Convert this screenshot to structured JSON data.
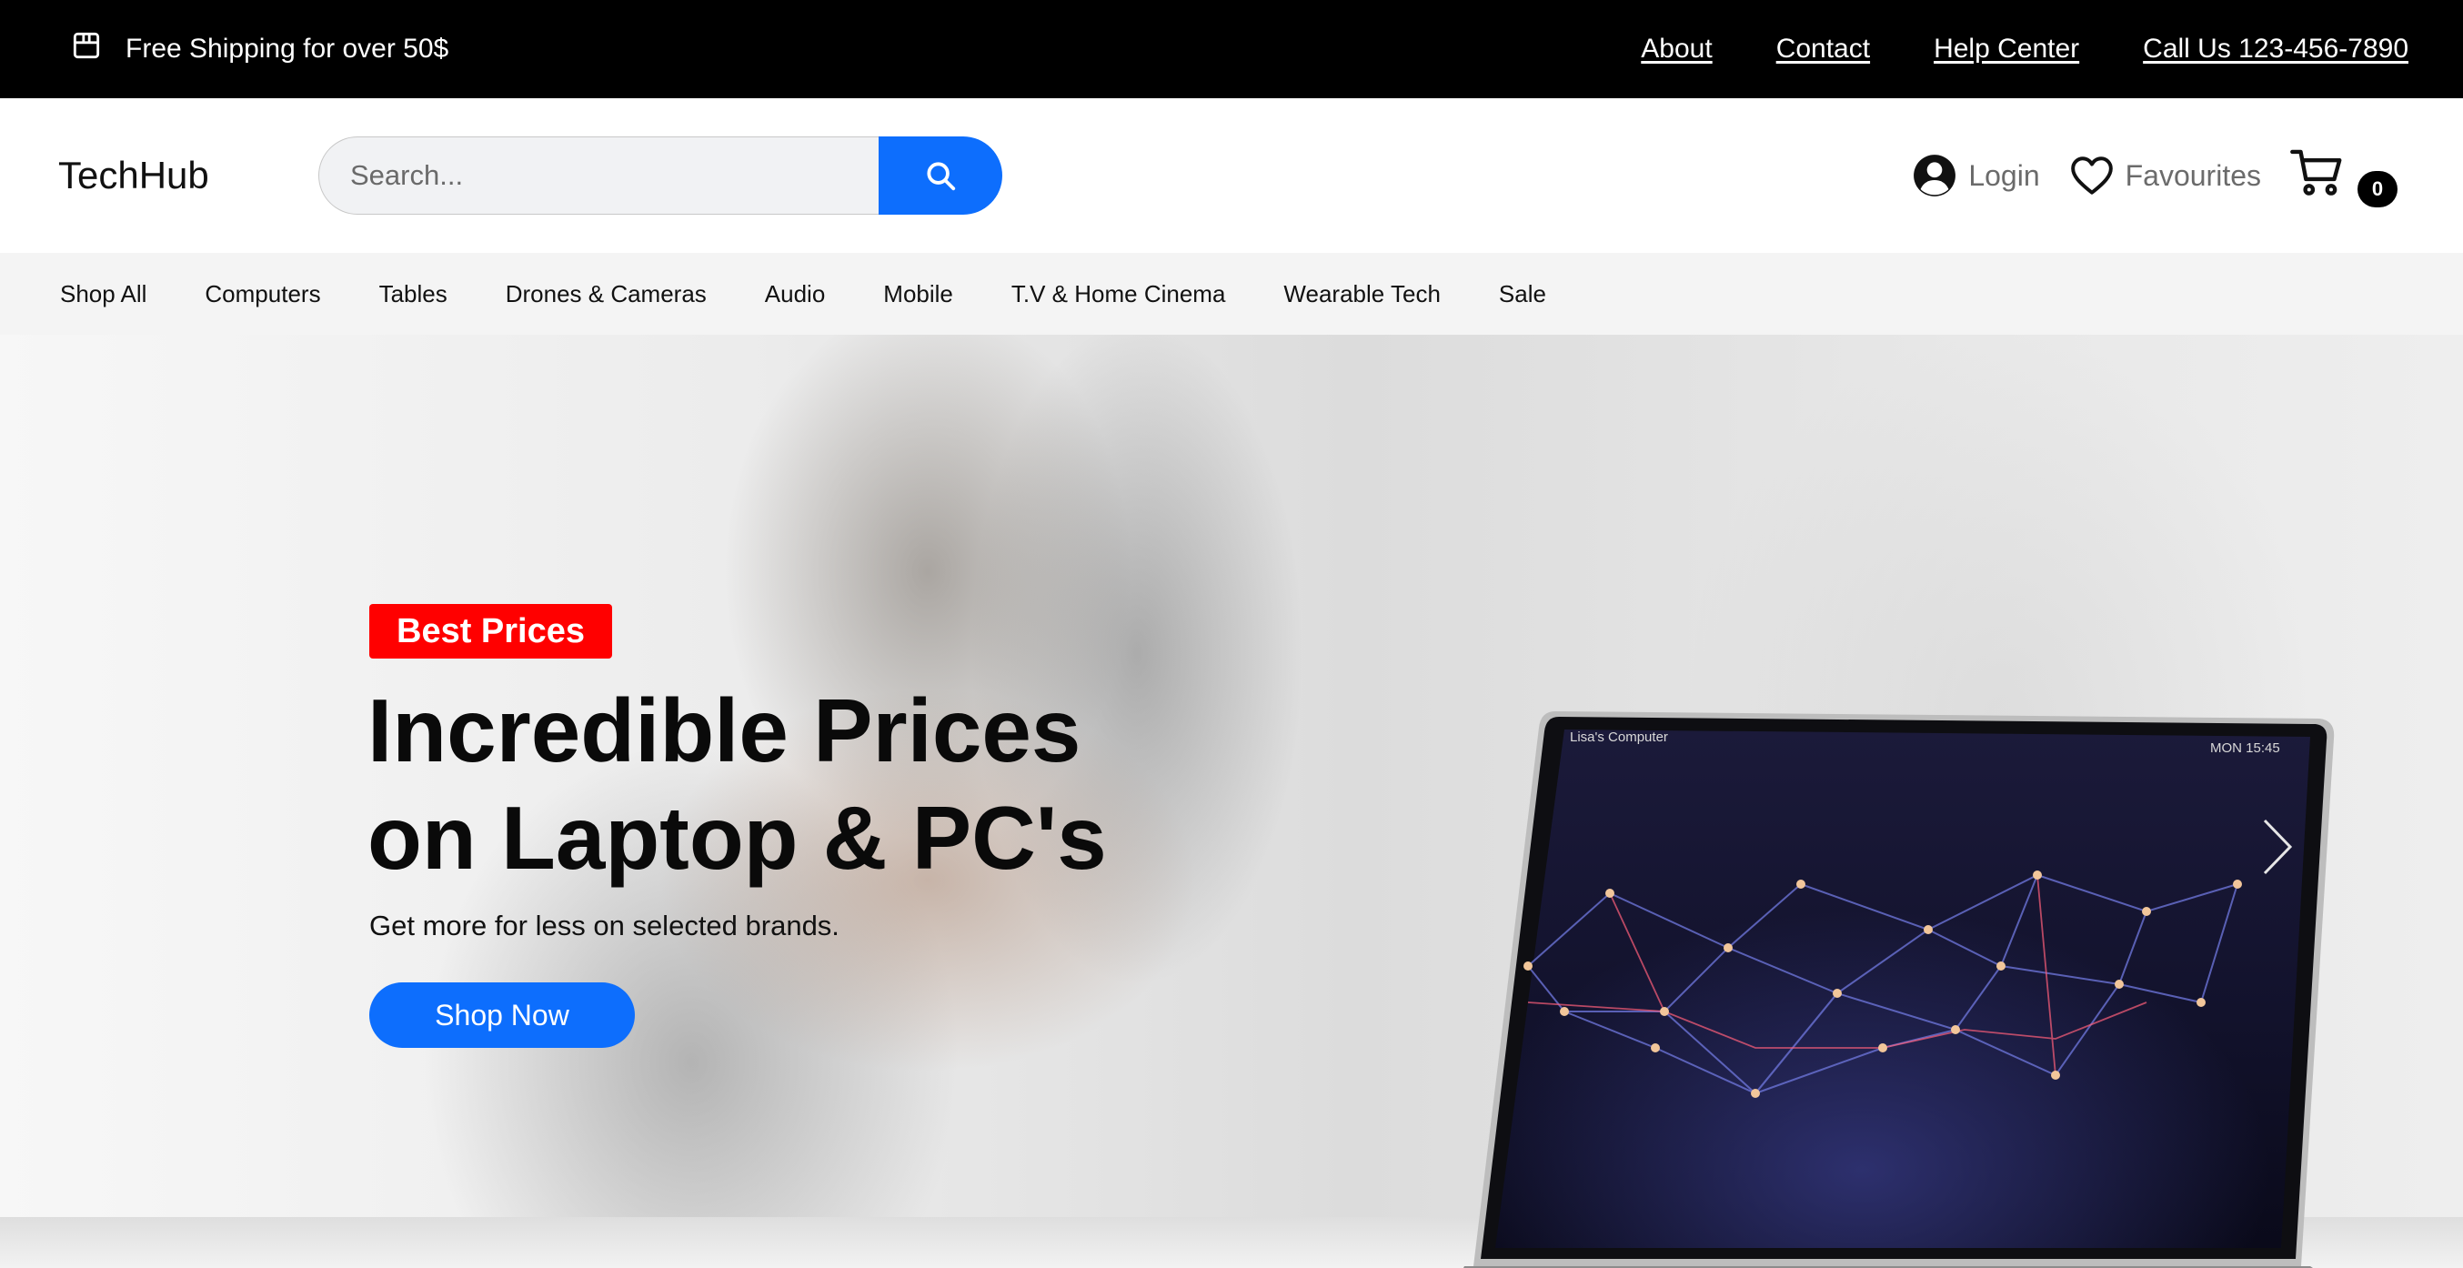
{
  "topbar": {
    "shipping_text": "Free Shipping for over 50$",
    "links": [
      "About",
      "Contact",
      "Help Center",
      "Call Us 123-456-7890"
    ]
  },
  "header": {
    "logo": "TechHub",
    "search_placeholder": "Search...",
    "login_label": "Login",
    "favourites_label": "Favourites",
    "cart_count": "0"
  },
  "nav": {
    "items": [
      "Shop All",
      "Computers",
      "Tables",
      "Drones & Cameras",
      "Audio",
      "Mobile",
      "T.V & Home Cinema",
      "Wearable Tech",
      "Sale"
    ]
  },
  "hero": {
    "badge": "Best Prices",
    "title_line1": "Incredible Prices",
    "title_line2": "on Laptop & PC's",
    "subtitle": "Get more for less on selected brands.",
    "cta": "Shop Now",
    "screen_label_left": "Lisa's Computer",
    "screen_label_right": "MON 15:45"
  },
  "colors": {
    "accent": "#0d6efd",
    "badge": "#ff0000",
    "topbar": "#000000"
  }
}
